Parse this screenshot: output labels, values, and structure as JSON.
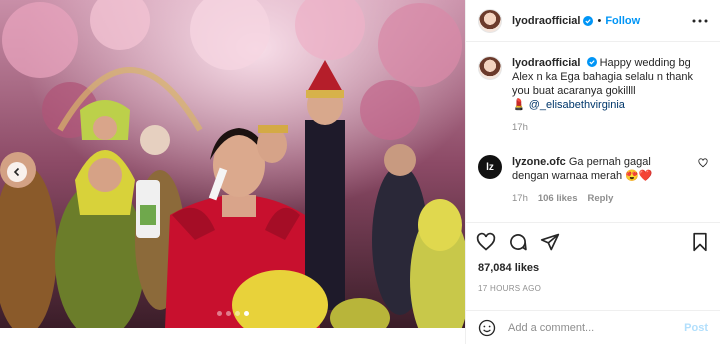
{
  "post": {
    "username": "lyodraofficial",
    "separator": "•",
    "follow_label": "Follow",
    "caption_username": "lyodraofficial",
    "caption_text": "Happy wedding bg Alex n ka Ega bahagia selalu n thank you buat acaranya gokillll",
    "caption_mention": "@_elisabethvirginia",
    "caption_emoji": "💄",
    "caption_time": "17h"
  },
  "comment": {
    "username": "lyzone.ofc",
    "avatar_text": "lz",
    "text": "Ga pernah gagal dengan warnaa merah 😍❤️",
    "time": "17h",
    "likes": "106 likes",
    "reply_label": "Reply"
  },
  "engagement": {
    "likes": "87,084 likes",
    "posted": "17 HOURS AGO"
  },
  "composer": {
    "placeholder": "Add a comment...",
    "post_label": "Post"
  },
  "carousel": {
    "slide_count": 4,
    "active_index": 3
  },
  "colors": {
    "accent": "#0095f6",
    "post_disabled": "#b2dffc",
    "verified": "#0095f6",
    "dress_red": "#c8102e",
    "hijab_yellow": "#e8d23a"
  },
  "icons": [
    "chevron-left-icon",
    "verified-icon",
    "more-icon",
    "heart-icon",
    "comment-icon",
    "share-icon",
    "bookmark-icon",
    "emoji-icon"
  ]
}
